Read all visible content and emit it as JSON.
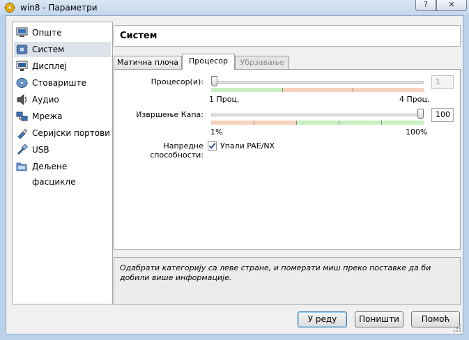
{
  "window": {
    "title": "win8 - Параметри",
    "help_button": "?",
    "close_button": "✕"
  },
  "sidebar": {
    "items": [
      {
        "label": "Опште",
        "icon": "monitor-general-icon"
      },
      {
        "label": "Систем",
        "icon": "chip-icon",
        "selected": true
      },
      {
        "label": "Дисплеј",
        "icon": "display-icon"
      },
      {
        "label": "Стовариште",
        "icon": "storage-disk-icon"
      },
      {
        "label": "Аудио",
        "icon": "speaker-icon"
      },
      {
        "label": "Мрежа",
        "icon": "network-icon"
      },
      {
        "label": "Серијски портови",
        "icon": "serial-plug-icon"
      },
      {
        "label": "USB",
        "icon": "usb-icon"
      },
      {
        "label": "Дељене фасцикле",
        "icon": "folder-icon"
      }
    ]
  },
  "header": {
    "title": "Систем"
  },
  "tabs": [
    {
      "label": "Матична плоча",
      "active": false,
      "disabled": false
    },
    {
      "label": "Процесор",
      "active": true,
      "disabled": false
    },
    {
      "label": "Убрзавање",
      "active": false,
      "disabled": true
    }
  ],
  "processor": {
    "label": "Процесор(и):",
    "min_label": "1 Проц.",
    "max_label": "4 Проц.",
    "value": "1",
    "slider_fraction": 0.0
  },
  "cap": {
    "label": "Извршење Капа:",
    "min_label": "1%",
    "max_label": "100%",
    "value": "100",
    "slider_fraction": 1.0
  },
  "extended": {
    "label": "Напредне способности:",
    "checkbox_label": "Упали PAE/NX",
    "checked": true
  },
  "info": {
    "text": "Одабрати категорију са леве стране, и померати миш преко поставке да би добили више информације."
  },
  "buttons": {
    "ok": "У реду",
    "cancel": "Поништи",
    "help": "Помоћ"
  },
  "colors": {
    "zone_green": "#c8f0c0",
    "zone_orange": "#f8d2bc",
    "selected_item": "#dde3ea",
    "title_bar": "#c4d6ec"
  }
}
